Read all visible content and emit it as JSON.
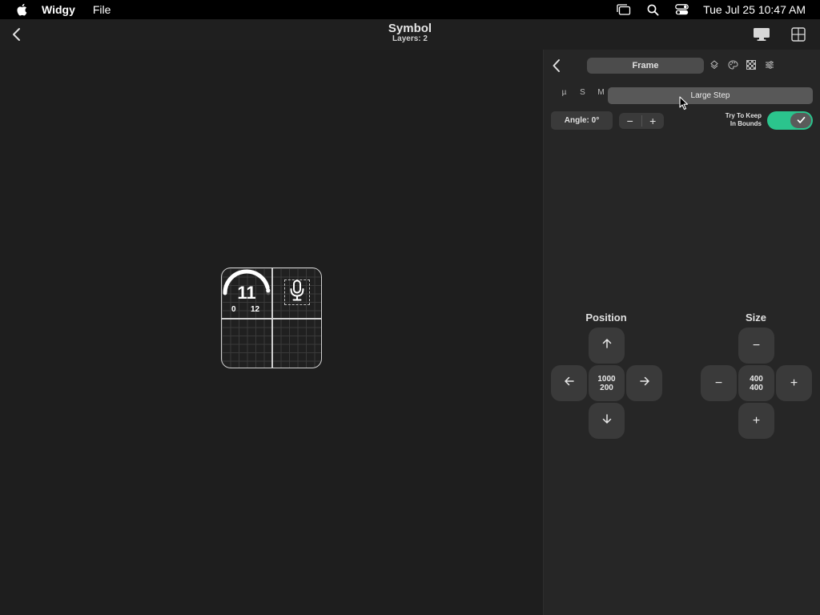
{
  "menubar": {
    "app_name": "Widgy",
    "menu_file": "File",
    "clock": "Tue Jul 25  10:47 AM",
    "icons": [
      "apple-logo-icon",
      "window-stack-icon",
      "search-icon",
      "control-center-icon"
    ]
  },
  "toolbar": {
    "title": "Symbol",
    "subtitle": "Layers: 2",
    "icons": [
      "back-chevron-icon",
      "monitor-icon",
      "grid-layout-icon"
    ]
  },
  "widget": {
    "gauge_value": "11",
    "gauge_min": "0",
    "gauge_max": "12",
    "gauge_level": 0.917,
    "symbol_icon": "microphone-icon"
  },
  "inspector": {
    "frame_tab": "Frame",
    "tab_icons": [
      "layers-icon",
      "palette-icon",
      "checkerboard-icon",
      "sliders-icon"
    ],
    "step_sizes": [
      "µ",
      "S",
      "M"
    ],
    "selected_step": "Large Step",
    "angle_label": "Angle: 0°",
    "angle_minus": "−",
    "angle_plus": "+",
    "keep_in_bounds_line1": "Try To Keep",
    "keep_in_bounds_line2": "In Bounds",
    "keep_in_bounds_on": true,
    "toggle_accent": "#2bc48d",
    "position": {
      "title": "Position",
      "x": "1000",
      "y": "200"
    },
    "size": {
      "title": "Size",
      "width": "400",
      "height": "400",
      "minus": "−",
      "plus": "+"
    }
  }
}
